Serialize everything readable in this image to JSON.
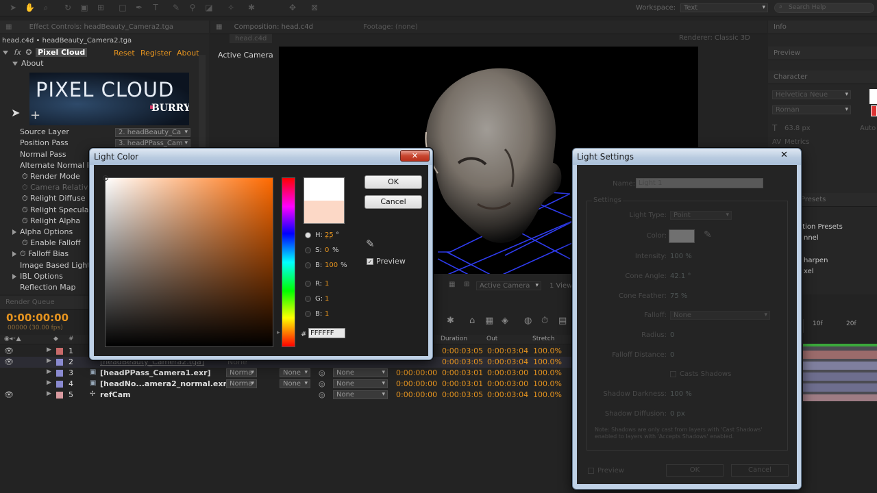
{
  "workspace": {
    "label": "Workspace:",
    "value": "Text",
    "search_placeholder": "Search Help"
  },
  "effect_controls": {
    "tab_label": "Effect Controls: headBeauty_Camera2.tga",
    "breadcrumb": "head.c4d • headBeauty_Camera2.tga",
    "effect_name": "Pixel Cloud",
    "fx_badge": "fx",
    "reset": "Reset",
    "register": "Register",
    "about": "About",
    "about_section": "About",
    "banner_title": "PIXEL CLOUD",
    "banner_brand": "BURRY",
    "rows": [
      {
        "label": "Source Layer",
        "value": "2. headBeauty_Ca"
      },
      {
        "label": "Position Pass",
        "value": "3. headPPass_Cam"
      },
      {
        "label": "Normal Pass"
      },
      {
        "label": "Alternate Normal Pa"
      },
      {
        "label": "Render Mode"
      },
      {
        "label": "Camera Relative"
      },
      {
        "label": "Relight Diffuse"
      },
      {
        "label": "Relight Specular"
      },
      {
        "label": "Relight Alpha"
      },
      {
        "label": "Alpha Options"
      },
      {
        "label": "Enable Falloff"
      },
      {
        "label": "Falloff Bias"
      },
      {
        "label": "Image Based Light"
      },
      {
        "label": "IBL Options"
      },
      {
        "label": "Reflection Map"
      }
    ],
    "render_queue_tab": "Render Queue"
  },
  "composition": {
    "tab_label": "Composition: head.c4d",
    "footage_tab": "Footage: (none)",
    "sub_tab": "head.c4d",
    "renderer_label": "Renderer:",
    "renderer_value": "Classic 3D",
    "active_camera_label": "Active Camera",
    "view_dropdown": "Active Camera",
    "view_count": "1 View"
  },
  "right_panels": {
    "info_tab": "Info",
    "preview_tab": "Preview",
    "character_tab": "Character",
    "font": "Helvetica Neue",
    "style": "Roman",
    "size": "63.8 px",
    "auto": "Auto",
    "metrics": "Metrics",
    "presets_tab": "Presets",
    "presets_items": [
      "ation Presets",
      "nnel",
      "harpen",
      "xel"
    ]
  },
  "light_color_dialog": {
    "title": "Light Color",
    "ok": "OK",
    "cancel": "Cancel",
    "h_label": "H:",
    "h_value": "25",
    "h_unit": "°",
    "s_label": "S:",
    "s_value": "0",
    "s_unit": "%",
    "b_label": "B:",
    "b_value": "100",
    "b_unit": "%",
    "r_label": "R:",
    "r_value": "1",
    "g_label": "G:",
    "g_value": "1",
    "bl_label": "B:",
    "bl_value": "1",
    "hex_label": "#",
    "hex_value": "FFFFFF",
    "preview_label": "Preview",
    "preview_checked": true,
    "hue_color": "#ff6a00",
    "new_swatch": "#ffffff",
    "old_swatch": "#fcd8c6"
  },
  "light_settings_dialog": {
    "title": "Light Settings",
    "name_label": "Name:",
    "name_value": "Light 1",
    "settings_group": "Settings",
    "light_type_label": "Light Type:",
    "light_type_value": "Point",
    "color_label": "Color:",
    "intensity_label": "Intensity:",
    "intensity_value": "100 %",
    "cone_angle_label": "Cone Angle:",
    "cone_angle_value": "42.1 °",
    "cone_feather_label": "Cone Feather:",
    "cone_feather_value": "75 %",
    "falloff_label": "Falloff:",
    "falloff_value": "None",
    "radius_label": "Radius:",
    "radius_value": "0",
    "falloff_distance_label": "Falloff Distance:",
    "falloff_distance_value": "0",
    "casts_shadows_label": "Casts Shadows",
    "shadow_darkness_label": "Shadow Darkness:",
    "shadow_darkness_value": "100 %",
    "shadow_diffusion_label": "Shadow Diffusion:",
    "shadow_diffusion_value": "0 px",
    "note": "Note: Shadows are only cast from layers with 'Cast Shadows' enabled to layers with 'Accepts Shadows' enabled.",
    "preview_label": "Preview",
    "ok": "OK",
    "cancel": "Cancel"
  },
  "timeline": {
    "timecode": "0:00:00:00",
    "fps": "00000 (30.00 fps)",
    "columns": {
      "num": "#",
      "duration": "Duration",
      "out": "Out",
      "stretch": "Stretch"
    },
    "ruler": [
      "10f",
      "20f"
    ],
    "layers": [
      {
        "num": "1",
        "name": "",
        "mode": "",
        "duration": "0:00:03:05",
        "out": "0:00:03:04",
        "stretch": "100.0%",
        "label_color": "#c86a6a"
      },
      {
        "num": "2",
        "name": "[headBeauty_Camera2.tga]",
        "mode": "None",
        "duration": "0:00:03:05",
        "out": "0:00:03:04",
        "stretch": "100.0%",
        "label_color": "#8a8ad0"
      },
      {
        "num": "3",
        "name": "[headPPass_Camera1.exr]",
        "mode": "Norma",
        "trkmat": "None",
        "parent": "None",
        "in": "0:00:00:00",
        "duration": "0:00:03:01",
        "out": "0:00:03:00",
        "stretch": "100.0%",
        "label_color": "#8a8ad0"
      },
      {
        "num": "4",
        "name": "[headNo...amera2_normal.exr]",
        "mode": "Norma",
        "trkmat": "None",
        "parent": "None",
        "in": "0:00:00:00",
        "duration": "0:00:03:01",
        "out": "0:00:03:00",
        "stretch": "100.0%",
        "label_color": "#8a8ad0"
      },
      {
        "num": "5",
        "name": "refCam",
        "mode": "",
        "parent": "None",
        "in": "0:00:00:00",
        "duration": "0:00:03:05",
        "out": "0:00:03:04",
        "stretch": "100.0%",
        "label_color": "#d99aa0"
      }
    ]
  }
}
